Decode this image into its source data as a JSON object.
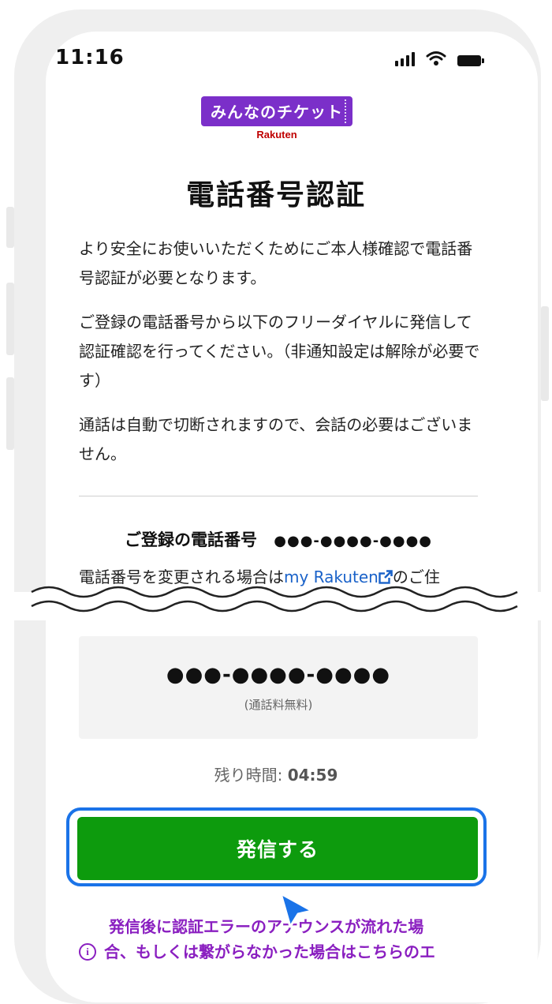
{
  "status_bar": {
    "time": "11:16"
  },
  "logo": {
    "main": "みんなのチケット",
    "sub": "Rakuten"
  },
  "page": {
    "title": "電話番号認証",
    "paragraphs": [
      "より安全にお使いいただくためにご本人様確認で電話番号認証が必要となります。",
      "ご登録の電話番号から以下のフリーダイヤルに発信して認証確認を行ってください。（非通知設定は解除が必要です）",
      "通話は自動で切断されますので、会話の必要はございません。"
    ]
  },
  "registered": {
    "label": "ご登録の電話番号",
    "masked_number": "●●●-●●●●-●●●●"
  },
  "change_notice": {
    "prefix": "電話番号を変更される場合は",
    "link_label": "my Rakuten",
    "suffix": "のご住"
  },
  "call_box": {
    "number": "●●●-●●●●-●●●●",
    "note": "(通話料無料)"
  },
  "timer": {
    "label": "残り時間: ",
    "value": "04:59"
  },
  "call_button": {
    "label": "発信する"
  },
  "error_note": {
    "line1": "発信後に認証エラーのアナウンスが流れた場",
    "line2": "合、もしくは繋がらなかった場合はこちらのエ"
  },
  "colors": {
    "brand_purple": "#7b2fc9",
    "rakuten_red": "#bf0000",
    "call_green": "#0d9b0d",
    "focus_blue": "#1a73e8",
    "link_blue": "#1a62c9",
    "note_purple": "#8a1fc0"
  },
  "icons": {
    "signal": "signal-bars-icon",
    "wifi": "wifi-icon",
    "battery": "battery-icon",
    "external_link": "external-link-icon",
    "info": "info-icon",
    "cursor": "pointer-cursor-icon"
  }
}
